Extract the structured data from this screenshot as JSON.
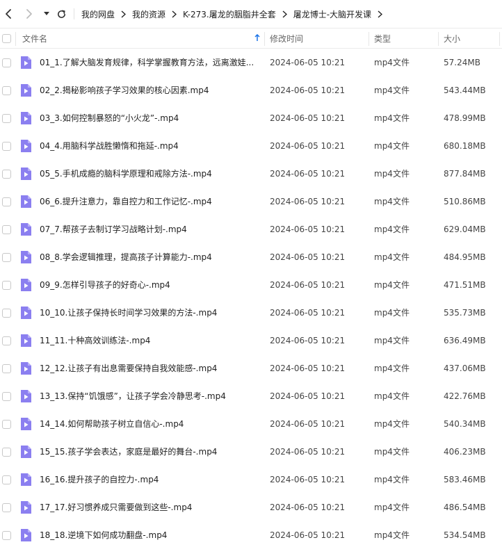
{
  "toolbar": {
    "breadcrumb": [
      "我的网盘",
      "我的资源",
      "K-273.屠龙的胭脂井全套",
      "屠龙博士-大脑开发课"
    ]
  },
  "header": {
    "name": "文件名",
    "time": "修改时间",
    "type": "类型",
    "size": "大小"
  },
  "colors": {
    "file_icon": "#8b7ff0",
    "file_icon_fold": "#b7aef7"
  },
  "files": [
    {
      "name": "01_1.了解大脑发育规律，科学掌握教育方法，远离激娃...",
      "time": "2024-06-05 10:21",
      "type": "mp4文件",
      "size": "57.24MB"
    },
    {
      "name": "02_2.揭秘影响孩子学习效果的核心因素.mp4",
      "time": "2024-06-05 10:21",
      "type": "mp4文件",
      "size": "543.44MB"
    },
    {
      "name": "03_3.如何控制暴怒的“小火龙”-.mp4",
      "time": "2024-06-05 10:21",
      "type": "mp4文件",
      "size": "478.99MB"
    },
    {
      "name": "04_4.用脑科学战胜懒惰和拖延-.mp4",
      "time": "2024-06-05 10:21",
      "type": "mp4文件",
      "size": "680.18MB"
    },
    {
      "name": "05_5.手机成瘾的脑科学原理和戒除方法-.mp4",
      "time": "2024-06-05 10:21",
      "type": "mp4文件",
      "size": "877.84MB"
    },
    {
      "name": "06_6.提升注意力，靠自控力和工作记忆-.mp4",
      "time": "2024-06-05 10:21",
      "type": "mp4文件",
      "size": "510.86MB"
    },
    {
      "name": "07_7.帮孩子去制订学习战略计划-.mp4",
      "time": "2024-06-05 10:21",
      "type": "mp4文件",
      "size": "629.04MB"
    },
    {
      "name": "08_8.学会逻辑推理，提高孩子计算能力-.mp4",
      "time": "2024-06-05 10:21",
      "type": "mp4文件",
      "size": "484.95MB"
    },
    {
      "name": "09_9.怎样引导孩子的好奇心-.mp4",
      "time": "2024-06-05 10:21",
      "type": "mp4文件",
      "size": "471.51MB"
    },
    {
      "name": "10_10.让孩子保持长时间学习效果的方法-.mp4",
      "time": "2024-06-05 10:21",
      "type": "mp4文件",
      "size": "535.73MB"
    },
    {
      "name": "11_11.十种高效训练法-.mp4",
      "time": "2024-06-05 10:21",
      "type": "mp4文件",
      "size": "636.49MB"
    },
    {
      "name": "12_12.让孩子有出息需要保持自我效能感-.mp4",
      "time": "2024-06-05 10:21",
      "type": "mp4文件",
      "size": "437.06MB"
    },
    {
      "name": "13_13.保持“饥饿感”，让孩子学会冷静思考-.mp4",
      "time": "2024-06-05 10:21",
      "type": "mp4文件",
      "size": "422.76MB"
    },
    {
      "name": "14_14.如何帮助孩子树立自信心-.mp4",
      "time": "2024-06-05 10:21",
      "type": "mp4文件",
      "size": "540.34MB"
    },
    {
      "name": "15_15.孩子学会表达，家庭是最好的舞台-.mp4",
      "time": "2024-06-05 10:21",
      "type": "mp4文件",
      "size": "406.23MB"
    },
    {
      "name": "16_16.提升孩子的自控力-.mp4",
      "time": "2024-06-05 10:21",
      "type": "mp4文件",
      "size": "583.46MB"
    },
    {
      "name": "17_17.好习惯养成只需要做到这些-.mp4",
      "time": "2024-06-05 10:21",
      "type": "mp4文件",
      "size": "486.54MB"
    },
    {
      "name": "18_18.逆境下如何成功翻盘-.mp4",
      "time": "2024-06-05 10:21",
      "type": "mp4文件",
      "size": "534.54MB"
    }
  ]
}
